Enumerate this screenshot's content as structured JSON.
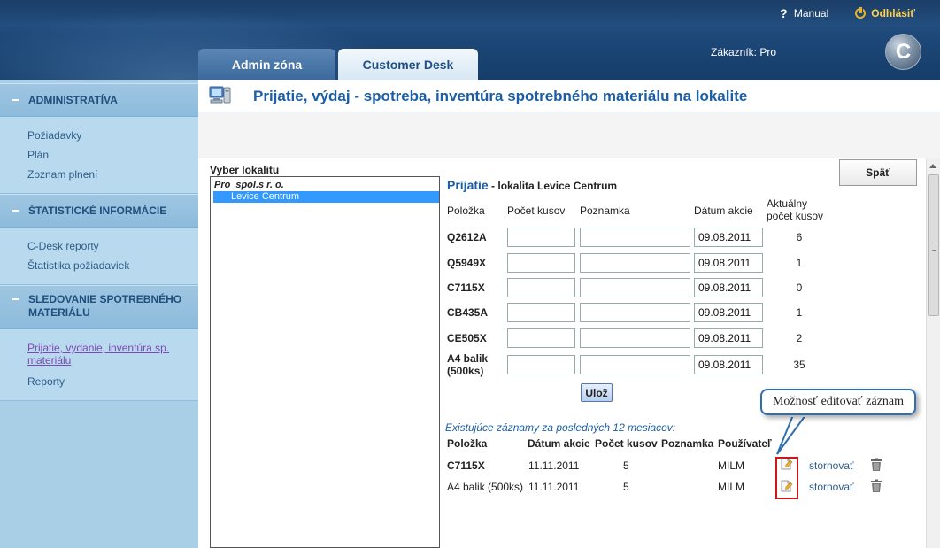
{
  "header": {
    "manual_label": "Manual",
    "logout_label": "Odhlásiť",
    "customer_label": "Zákazník: Pro",
    "logo_letter": "C",
    "tabs": [
      {
        "label": "Admin zóna",
        "active": false
      },
      {
        "label": "Customer Desk",
        "active": true
      }
    ]
  },
  "sidebar": {
    "sections": [
      {
        "title": "ADMINISTRATÍVA",
        "items": [
          "Požiadavky",
          "Plán",
          "Zoznam plnení"
        ]
      },
      {
        "title": "ŠTATISTICKÉ INFORMÁCIE",
        "items": [
          "C-Desk reporty",
          "Štatistika požiadaviek"
        ]
      },
      {
        "title_line1": "SLEDOVANIE SPOTREBNÉHO",
        "title_line2": "MATERIÁLU",
        "items": [
          {
            "label_line1": "Prijatie, vydanie, inventúra sp.",
            "label_line2": "materiálu",
            "active": true
          },
          "Reporty"
        ]
      }
    ]
  },
  "page": {
    "title": "Prijatie, výdaj - spotreba, inventúra spotrebného materiálu na lokalite"
  },
  "location_panel": {
    "label": "Vyber lokalitu",
    "root_name": "Pro",
    "root_suffix": "spol.s r. o.",
    "selected": "Levice Centrum"
  },
  "back_button": "Späť",
  "receive_form": {
    "title": "Prijatie",
    "subtitle": " - lokalita Levice Centrum",
    "headers": {
      "item": "Položka",
      "qty": "Počet kusov",
      "note": "Poznamka",
      "date": "Dátum akcie",
      "current_line1": "Aktuálny",
      "current_line2": "počet kusov"
    },
    "rows": [
      {
        "item": "Q2612A",
        "date": "09.08.2011",
        "count": "6"
      },
      {
        "item": "Q5949X",
        "date": "09.08.2011",
        "count": "1"
      },
      {
        "item": "C7115X",
        "date": "09.08.2011",
        "count": "0"
      },
      {
        "item": "CB435A",
        "date": "09.08.2011",
        "count": "1"
      },
      {
        "item": "CE505X",
        "date": "09.08.2011",
        "count": "2"
      },
      {
        "item_line1": "A4 balik",
        "item_line2": "(500ks)",
        "date": "09.08.2011",
        "count": "35"
      }
    ],
    "save_label": "Ulož"
  },
  "existing": {
    "title": "Existujúce záznamy za posledných 12 mesiacov:",
    "headers": {
      "item": "Položka",
      "date": "Dátum akcie",
      "qty": "Počet kusov",
      "note": "Poznamka",
      "user": "Používateľ"
    },
    "rows": [
      {
        "item": "C7115X",
        "date": "11.11.2011",
        "qty": "5",
        "user": "MILM",
        "action": "stornovať"
      },
      {
        "item": "A4 balik (500ks)",
        "date": "11.11.2011",
        "qty": "5",
        "user": "MILM",
        "action": "stornovať"
      }
    ]
  },
  "callout": {
    "text": "Možnosť editovať záznam"
  },
  "colors": {
    "header_bg": "#1d4878",
    "sidebar_bg": "#a9cfe7",
    "title_blue": "#1a5ea8",
    "logout_yellow": "#ffd34a",
    "highlight_red": "#cc1818",
    "selection_blue": "#3399ff"
  },
  "icons": [
    "help-icon",
    "power-icon",
    "computer-icon",
    "edit-record-icon",
    "trash-icon"
  ]
}
